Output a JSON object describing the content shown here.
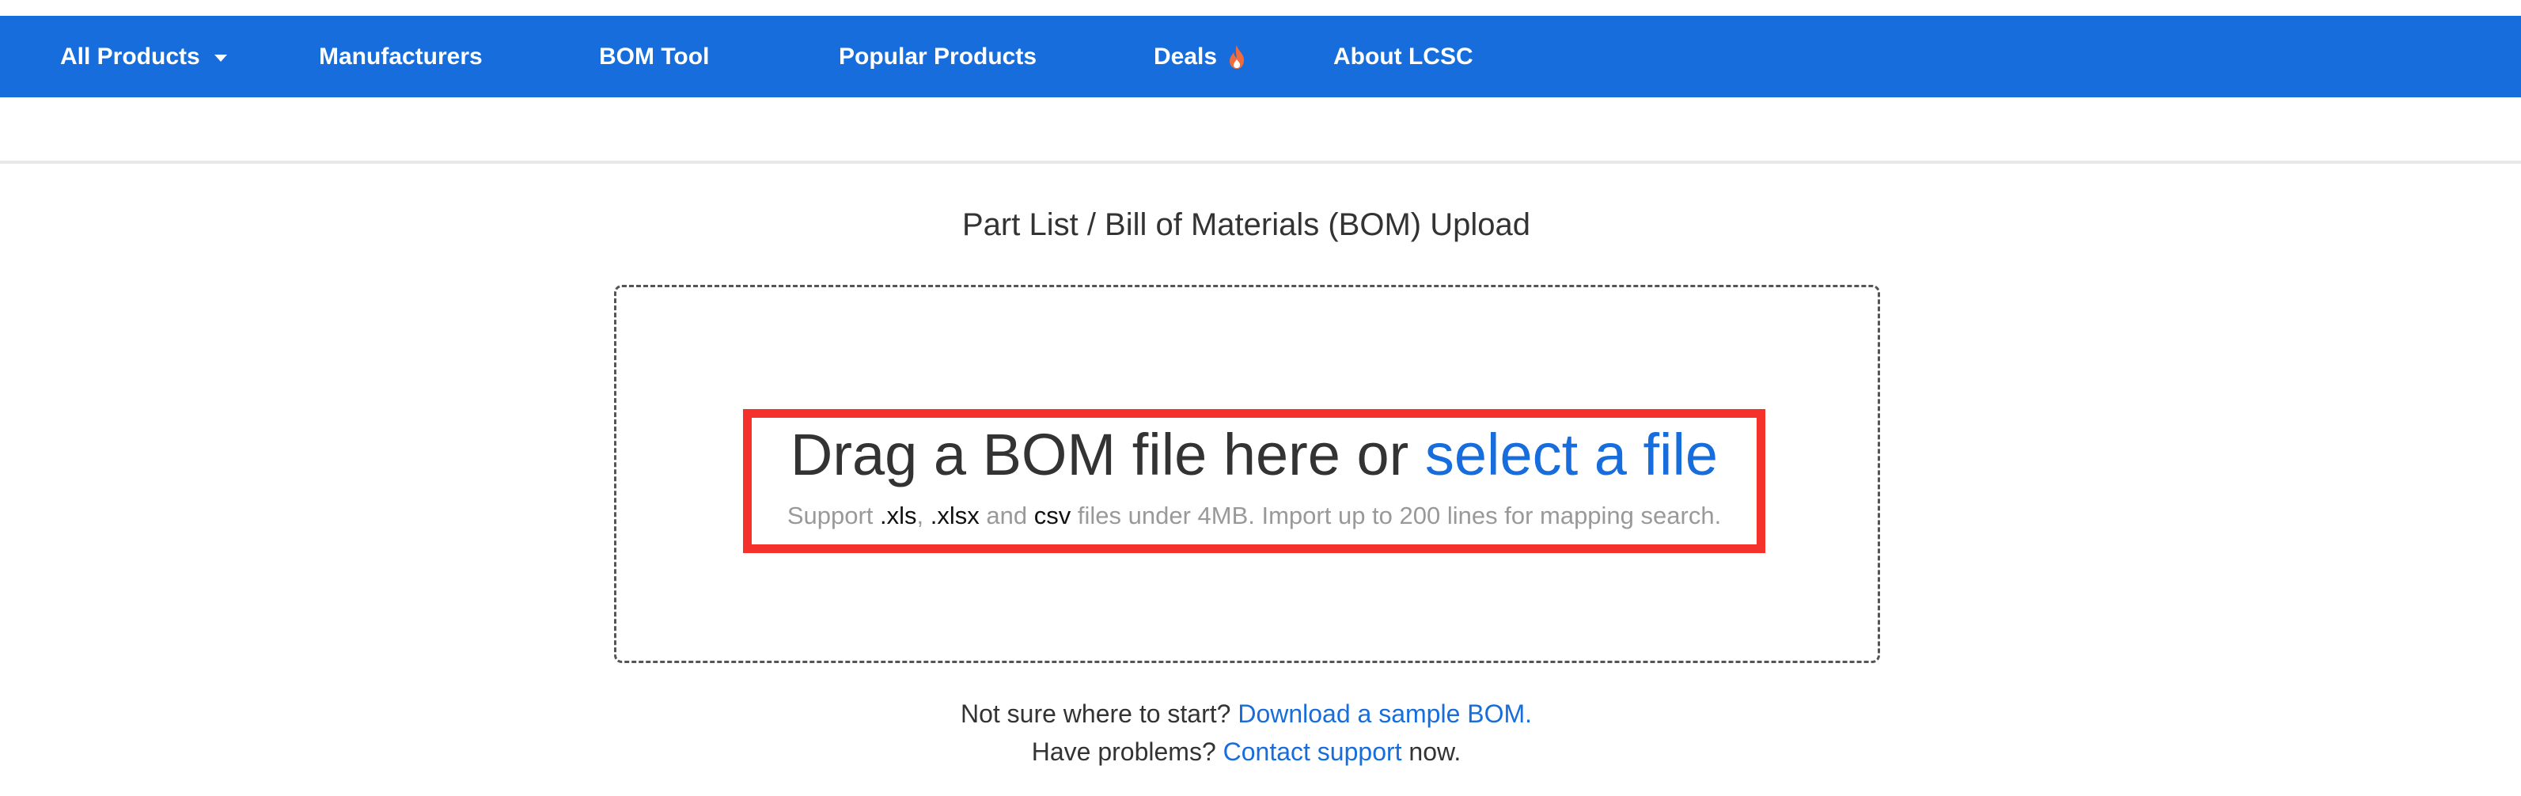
{
  "nav": {
    "all_products": "All Products",
    "manufacturers": "Manufacturers",
    "bom_tool": "BOM Tool",
    "popular_products": "Popular Products",
    "deals": "Deals",
    "about": "About LCSC"
  },
  "colors": {
    "nav_bg": "#166ddb",
    "link": "#166ddb",
    "highlight": "#f4312a",
    "flame": "#f26b3a"
  },
  "icons": {
    "dropdown": "caret-down-icon",
    "deals": "flame-icon"
  },
  "main": {
    "title": "Part List / Bill of Materials (BOM) Upload",
    "drop_text": "Drag a BOM file here or",
    "select_link": "select a file",
    "support_prefix": "Support",
    "ext_xls": ".xls",
    "sep1": ",",
    "ext_xlsx": ".xlsx",
    "and_text": "and",
    "ext_csv": "csv",
    "support_suffix": "files under 4MB. Import up to 200 lines for mapping search."
  },
  "help": {
    "line1_text": "Not sure where to start?",
    "line1_link": "Download a sample BOM.",
    "line2_text": "Have problems?",
    "line2_link": "Contact support",
    "line2_suffix": "now."
  }
}
